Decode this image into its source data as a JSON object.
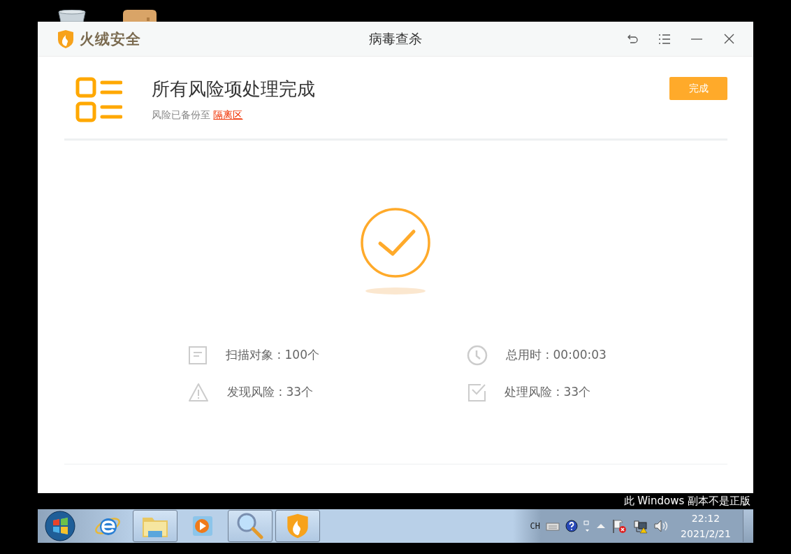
{
  "window": {
    "brand": "火绒安全",
    "title": "病毒查杀"
  },
  "result": {
    "heading": "所有风险项处理完成",
    "note": "风险已备份至",
    "link": "隔离区",
    "button": "完成"
  },
  "stats": [
    {
      "kind": "scan",
      "text": "扫描对象 : 100个"
    },
    {
      "kind": "time",
      "text": "总用时 : 00:00:03"
    },
    {
      "kind": "found",
      "text": "发现风险 : 33个"
    },
    {
      "kind": "handled",
      "text": "处理风险 : 33个"
    }
  ],
  "activation_notice": "此 Windows 副本不是正版",
  "taskbar": {
    "items": [
      {
        "kind": "browser",
        "running": false
      },
      {
        "kind": "folder",
        "running": true
      },
      {
        "kind": "media",
        "running": false
      },
      {
        "kind": "search",
        "running": true
      },
      {
        "kind": "shield",
        "running": true
      }
    ],
    "language": "CH",
    "time": "22:12",
    "date": "2021/2/21"
  }
}
